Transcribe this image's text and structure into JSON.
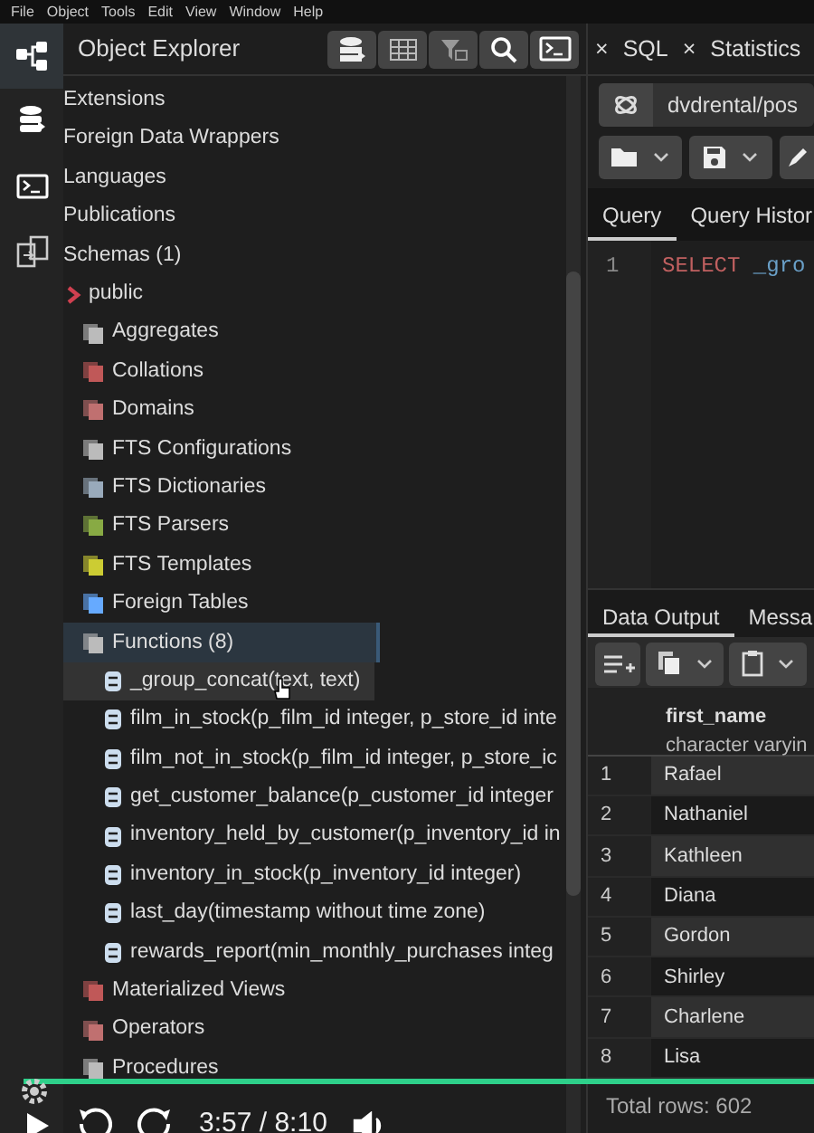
{
  "menu": [
    "File",
    "Object",
    "Tools",
    "Edit",
    "View",
    "Window",
    "Help"
  ],
  "sidebar": {
    "items": [
      {
        "selected": true
      },
      {
        "selected": false
      },
      {
        "selected": false
      },
      {
        "selected": false
      }
    ]
  },
  "object_explorer": {
    "title": "Object Explorer",
    "tree": [
      {
        "label": "Extensions",
        "selected": false
      },
      {
        "label": "Foreign Data Wrappers",
        "selected": false
      },
      {
        "label": "Languages",
        "selected": false
      },
      {
        "label": "Publications",
        "selected": false
      },
      {
        "label": "Schemas (1)",
        "selected": false,
        "children": [
          {
            "label": "public",
            "selected": false,
            "children": [
              {
                "label": "Aggregates",
                "selected": false
              },
              {
                "label": "Collations",
                "selected": false
              },
              {
                "label": "Domains",
                "selected": false
              },
              {
                "label": "FTS Configurations",
                "selected": false
              },
              {
                "label": "FTS Dictionaries",
                "selected": false
              },
              {
                "label": "FTS Parsers",
                "selected": false
              },
              {
                "label": "FTS Templates",
                "selected": false
              },
              {
                "label": "Foreign Tables",
                "selected": false
              },
              {
                "label": "Functions (8)",
                "selected": true,
                "children": [
                  {
                    "label": "_group_concat(text, text)",
                    "selected": false,
                    "hovered": true
                  },
                  {
                    "label": "film_in_stock(p_film_id integer, p_store_id inte",
                    "selected": false,
                    "hovered": false
                  },
                  {
                    "label": "film_not_in_stock(p_film_id integer, p_store_ic",
                    "selected": false,
                    "hovered": false
                  },
                  {
                    "label": "get_customer_balance(p_customer_id integer",
                    "selected": false,
                    "hovered": false
                  },
                  {
                    "label": "inventory_held_by_customer(p_inventory_id in",
                    "selected": false,
                    "hovered": false
                  },
                  {
                    "label": "inventory_in_stock(p_inventory_id integer)",
                    "selected": false,
                    "hovered": false
                  },
                  {
                    "label": "last_day(timestamp without time zone)",
                    "selected": false,
                    "hovered": false
                  },
                  {
                    "label": "rewards_report(min_monthly_purchases integ",
                    "selected": false,
                    "hovered": false
                  }
                ]
              },
              {
                "label": "Materialized Views",
                "selected": false
              },
              {
                "label": "Operators",
                "selected": false
              },
              {
                "label": "Procedures",
                "selected": false
              }
            ]
          }
        ]
      }
    ]
  },
  "tabs": [
    {
      "label": "×"
    },
    {
      "label": "SQL"
    },
    {
      "label": "×"
    },
    {
      "label": "Statistics"
    }
  ],
  "connection": "dvdrental/pos",
  "query_tabs": [
    {
      "label": "Query",
      "selected": true
    },
    {
      "label": "Query Histor",
      "selected": false
    }
  ],
  "query": {
    "line_numbers": [
      "1"
    ],
    "keyword": "SELECT",
    "rest": "_gro"
  },
  "output_tabs": [
    {
      "label": "Data Output",
      "selected": true
    },
    {
      "label": "Messa",
      "selected": false
    }
  ],
  "table": {
    "columns": [
      {
        "name": "first_name",
        "type": "character varyin"
      }
    ],
    "rows": [
      {
        "num": "1",
        "first_name": "Rafael"
      },
      {
        "num": "2",
        "first_name": "Nathaniel"
      },
      {
        "num": "3",
        "first_name": "Kathleen"
      },
      {
        "num": "4",
        "first_name": "Diana"
      },
      {
        "num": "5",
        "first_name": "Gordon"
      },
      {
        "num": "6",
        "first_name": "Shirley"
      },
      {
        "num": "7",
        "first_name": "Charlene"
      },
      {
        "num": "8",
        "first_name": "Lisa"
      }
    ]
  },
  "status": "Total rows: 602",
  "video_player": {
    "current_time": "3:57",
    "separator": "/",
    "duration": "8:10"
  }
}
